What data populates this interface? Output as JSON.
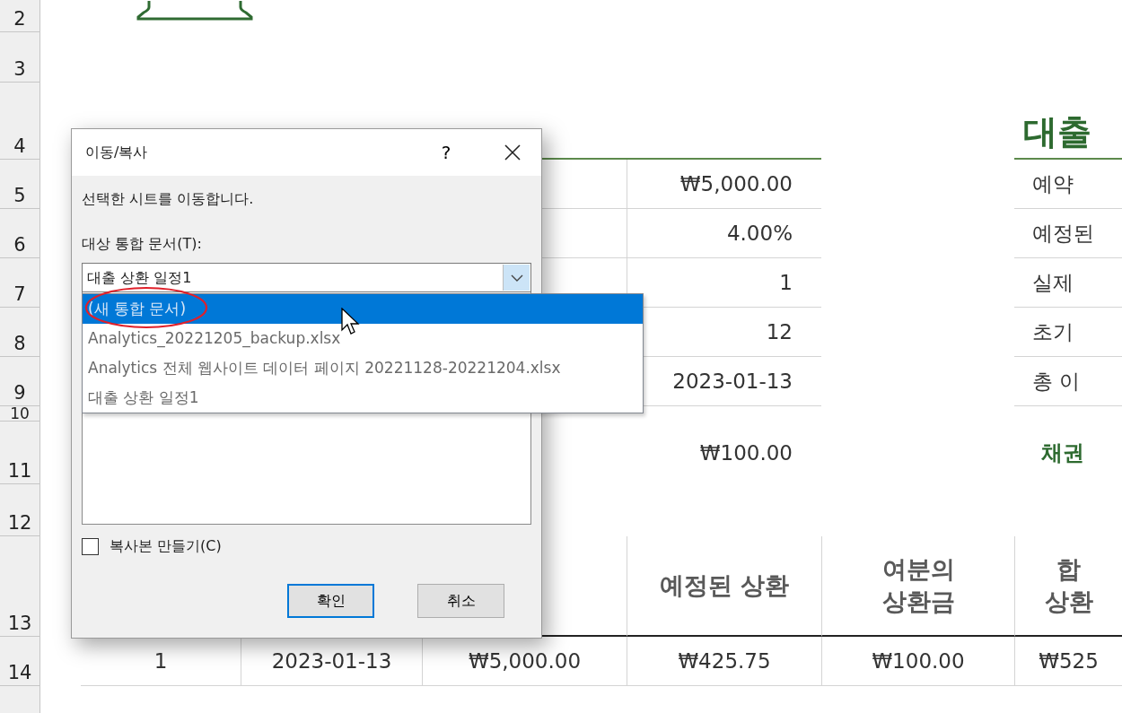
{
  "sheet": {
    "rows": [
      {
        "number": "2",
        "kind": "logo",
        "cells": []
      },
      {
        "number": "3",
        "kind": "blank",
        "cells": []
      },
      {
        "number": "4",
        "kind": "title",
        "cells": [
          "",
          "",
          "",
          "",
          "",
          "",
          "대출"
        ]
      },
      {
        "number": "5",
        "kind": "field",
        "cells": [
          "",
          "",
          "",
          "",
          "₩5,000.00",
          "",
          "예약"
        ]
      },
      {
        "number": "6",
        "kind": "field",
        "cells": [
          "",
          "",
          "",
          "",
          "4.00%",
          "",
          "예정된"
        ]
      },
      {
        "number": "7",
        "kind": "field",
        "cells": [
          "",
          "",
          "",
          "",
          "1",
          "",
          "실제"
        ]
      },
      {
        "number": "8",
        "kind": "field",
        "cells": [
          "",
          "",
          "",
          "",
          "12",
          "",
          "초기"
        ]
      },
      {
        "number": "9",
        "kind": "field",
        "cells": [
          "",
          "",
          "",
          "",
          "2023-01-13",
          "",
          "총 이"
        ]
      },
      {
        "number": "10",
        "kind": "blank",
        "cells": []
      },
      {
        "number": "11",
        "kind": "subtotal",
        "cells": [
          "",
          "",
          "",
          "",
          "₩100.00",
          "",
          "채권"
        ]
      },
      {
        "number": "12",
        "kind": "blank",
        "cells": []
      },
      {
        "number": "13",
        "kind": "header",
        "cells": [
          "",
          "",
          "",
          "",
          "예정된 상환",
          "여분의\n상환금",
          "합\n상환"
        ]
      },
      {
        "number": "14",
        "kind": "data",
        "cells": [
          "",
          "1",
          "2023-01-13",
          "₩5,000.00",
          "₩425.75",
          "₩100.00",
          "₩525"
        ]
      }
    ]
  },
  "dialog": {
    "title": "이동/복사",
    "help": "?",
    "message": "선택한 시트를 이동합니다.",
    "target_label": "대상 통합 문서(T):",
    "combo": {
      "value": "대출 상환 일정1",
      "expanded": true
    },
    "dropdown": {
      "items": [
        {
          "text": "(새 통합 문서)",
          "selected": true
        },
        {
          "text": "Analytics_20221205_backup.xlsx",
          "selected": false
        },
        {
          "text": "Analytics 전체 웹사이트 데이터 페이지 20221128-20221204.xlsx",
          "selected": false
        },
        {
          "text": "대출 상환 일정1",
          "selected": false
        }
      ]
    },
    "copy_checkbox": {
      "label": "복사본 만들기(C)",
      "checked": false
    },
    "buttons": [
      {
        "label": "확인",
        "default": true
      },
      {
        "label": "취소",
        "default": false
      }
    ]
  }
}
